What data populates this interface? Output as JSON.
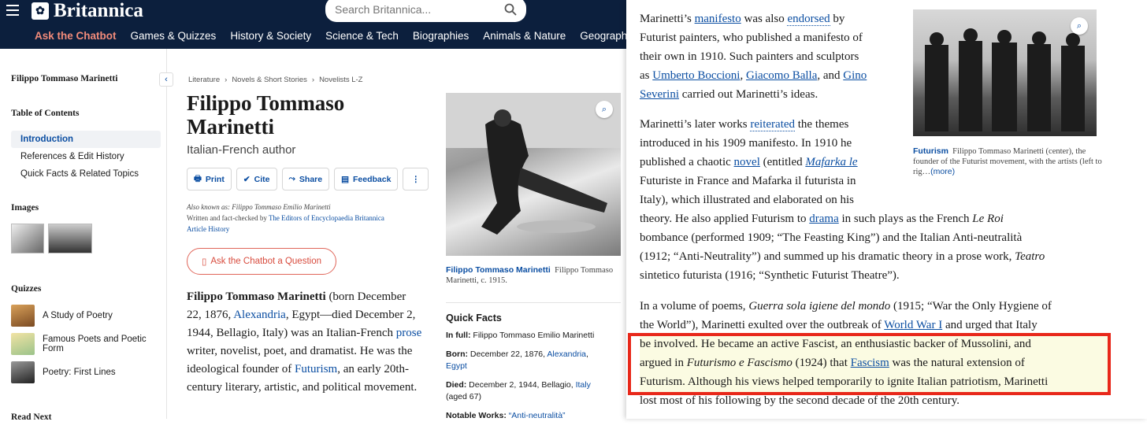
{
  "brand": {
    "name": "Britannica"
  },
  "search": {
    "placeholder": "Search Britannica..."
  },
  "nav": [
    "Ask the Chatbot",
    "Games & Quizzes",
    "History & Society",
    "Science & Tech",
    "Biographies",
    "Animals & Nature",
    "Geography & T"
  ],
  "sidebar": {
    "title": "Filippo Tommaso Marinetti",
    "toc_heading": "Table of Contents",
    "toc": [
      "Introduction",
      "References & Edit History",
      "Quick Facts & Related Topics"
    ],
    "images_heading": "Images",
    "quizzes_heading": "Quizzes",
    "quizzes": [
      "A Study of Poetry",
      "Famous Poets and Poetic Form",
      "Poetry: First Lines"
    ],
    "read_next": "Read Next"
  },
  "breadcrumbs": [
    "Literature",
    "Novels & Short Stories",
    "Novelists L-Z"
  ],
  "article": {
    "title": "Filippo Tommaso Marinetti",
    "subtitle": "Italian-French author",
    "actions": [
      "Print",
      "Cite",
      "Share",
      "Feedback"
    ],
    "also_known": "Also known as: Filippo Tommaso Emilio Marinetti",
    "written_by": "Written and fact-checked by",
    "editors": "The Editors of Encyclopaedia Britannica",
    "history": "Article History",
    "ask": "Ask the Chatbot a Question",
    "intro_bold": "Filippo Tommaso Marinetti",
    "intro_1": " (born December 22, 1876, ",
    "intro_link1": "Alexandria",
    "intro_2": ", Egypt—died December 2, 1944, Bellagio, Italy) was an Italian-French ",
    "intro_link2": "prose",
    "intro_3": " writer, novelist, poet, and dramatist. He was the ideological founder of ",
    "intro_link3": "Futurism",
    "intro_4": ", an early 20th-century literary, artistic, and political movement."
  },
  "hero": {
    "caption_name": "Filippo Tommaso Marinetti",
    "caption_text": "Filippo Tommaso Marinetti, c. 1915."
  },
  "quickfacts": {
    "title": "Quick Facts",
    "full_label": "In full:",
    "full_value": "Filippo Tommaso Emilio Marinetti",
    "born_label": "Born:",
    "born_value": "December 22, 1876, ",
    "born_link": "Alexandria",
    "born_link2": "Egypt",
    "died_label": "Died:",
    "died_value": "December 2, 1944, Bellagio, ",
    "died_link": "Italy",
    "died_age": "(aged 67)",
    "notable": "Notable Works:",
    "notable_value": "“Anti-neutralità”"
  },
  "panel": {
    "p1": [
      "Marinetti’s ",
      "manifesto",
      " was also ",
      "endorsed",
      " by",
      "Futurist painters, who published a manifesto of",
      "their own in 1910. Such painters and sculptors",
      "as ",
      "Umberto Boccioni",
      ", ",
      "Giacomo Balla",
      ", and ",
      "Gino",
      "Severini",
      " carried out Marinetti’s ideas."
    ],
    "p2_lines": [
      "Marinetti’s later works |reiterated| the themes",
      "introduced in his 1909 manifesto. In 1910 he",
      "published a chaotic |novel| (entitled |Mafarka le",
      "Futuriste| in France and |Mafarka il futurista| in",
      "Italy), which illustrated and elaborated on his",
      "theory. He also applied Futurism to |drama| in such plays as the French |Le Roi",
      "bombance| (performed 1909; “The Feasting King”) and the Italian |Anti-neutralità",
      "(1912; “Anti-Neutrality”) and summed up his dramatic theory in a prose work, |Teatro",
      "sintetico futurista| (1916; “Synthetic Futurist Theatre”)."
    ],
    "caption_name": "Futurism",
    "caption_text": "Filippo Tommaso Marinetti (center), the founder of the Futurist movement, with the artists (left to rig…",
    "more": "(more)",
    "p3": {
      "l1a": "In a volume of poems, ",
      "l1i": "Guerra sola igiene del mondo",
      "l1b": " (1915; “War the Only Hygiene of",
      "l2a": "the World”), Marinetti exulted over the outbreak of ",
      "l2link": "World War I",
      "l2b": " and urged that Italy",
      "l3": "be involved. He became an active Fascist, an enthusiastic backer of Mussolini, and",
      "l4a": "argued in ",
      "l4i": "Futurismo e Fascismo",
      "l4b": " (1924) that ",
      "l4link": "Fascism",
      "l4c": " was the natural extension of",
      "l5": "Futurism. Although his views helped temporarily to ignite Italian patriotism, Marinetti",
      "l6": "lost most of his following by the second decade of the 20th century."
    }
  }
}
